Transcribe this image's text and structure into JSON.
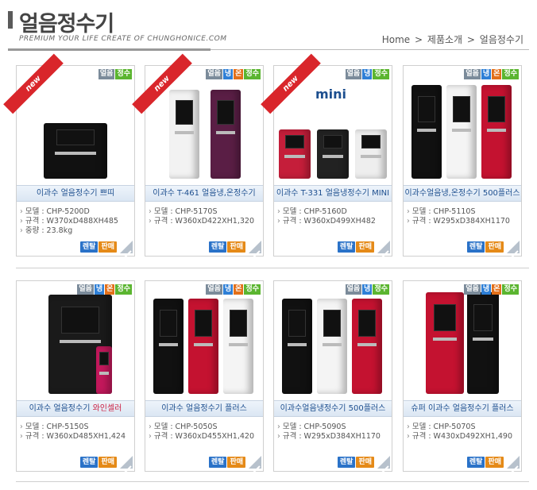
{
  "header": {
    "title": "얼음정수기",
    "subtitle": "PREMIUM YOUR LIFE CREATE OF CHUNGHONICE.COM",
    "breadcrumb": [
      "Home",
      ">",
      "제품소개",
      ">",
      "얼음정수기"
    ]
  },
  "labels": {
    "rent": "렌탈",
    "sale": "판매",
    "new": "new",
    "mini": "mini"
  },
  "badge_labels": {
    "ice": "얼음",
    "cold": "냉",
    "hot": "온",
    "pure": "정수"
  },
  "colors": {
    "cold": "#2e7fd6",
    "hot": "#e3701a",
    "pure": "#5bb530",
    "ice": "#7b8b9a",
    "name": "#1d4f8f",
    "rent": "#2a72c8",
    "sale": "#e58a18",
    "new_ribbon": "#d9262b"
  },
  "products": [
    {
      "name": "이과수 얼음정수기 쁘띠",
      "specs": [
        "모델 : CHP-5200D",
        "규격 : W370xD488XH485",
        "중량 : 23.8kg"
      ],
      "badges": [
        "ice",
        "pure"
      ],
      "new": true
    },
    {
      "name": "이과수 T-461 얼음냉,온정수기",
      "specs": [
        "모델 : CHP-5170S",
        "규격 : W360xD422XH1,320"
      ],
      "badges": [
        "ice",
        "cold",
        "hot",
        "pure"
      ],
      "new": true
    },
    {
      "name": "이과수 T-331 얼음냉정수기 MINI",
      "specs": [
        "모델 : CHP-5160D",
        "규격 : W360xD499XH482"
      ],
      "badges": [
        "ice",
        "cold",
        "pure"
      ],
      "new": true
    },
    {
      "name": "이과수얼음냉,온정수기 500플러스",
      "specs": [
        "모델 : CHP-5110S",
        "규격 : W295xD384XH1170"
      ],
      "badges": [
        "ice",
        "cold",
        "hot",
        "pure"
      ],
      "new": false
    },
    {
      "name": "이과수 얼음정수기 ",
      "name_highlight": "와인셀러",
      "specs": [
        "모델 : CHP-5150S",
        "규격 : W360xD485XH1,424"
      ],
      "badges": [
        "ice",
        "cold",
        "hot",
        "pure"
      ],
      "new": false
    },
    {
      "name": "이과수 얼음정수기 플러스",
      "specs": [
        "모델 : CHP-5050S",
        "규격 : W360xD455XH1,420"
      ],
      "badges": [
        "ice",
        "cold",
        "hot",
        "pure"
      ],
      "new": false
    },
    {
      "name": "이과수얼음냉정수기 500플러스",
      "specs": [
        "모델 : CHP-5090S",
        "규격 : W295xD384XH1170"
      ],
      "badges": [
        "ice",
        "cold",
        "pure"
      ],
      "new": false
    },
    {
      "name": "슈퍼 이과수 얼음정수기 플러스",
      "specs": [
        "모델 : CHP-5070S",
        "규격 : W430xD492XH1,490"
      ],
      "badges": [
        "ice",
        "cold",
        "hot",
        "pure"
      ],
      "new": false
    }
  ]
}
